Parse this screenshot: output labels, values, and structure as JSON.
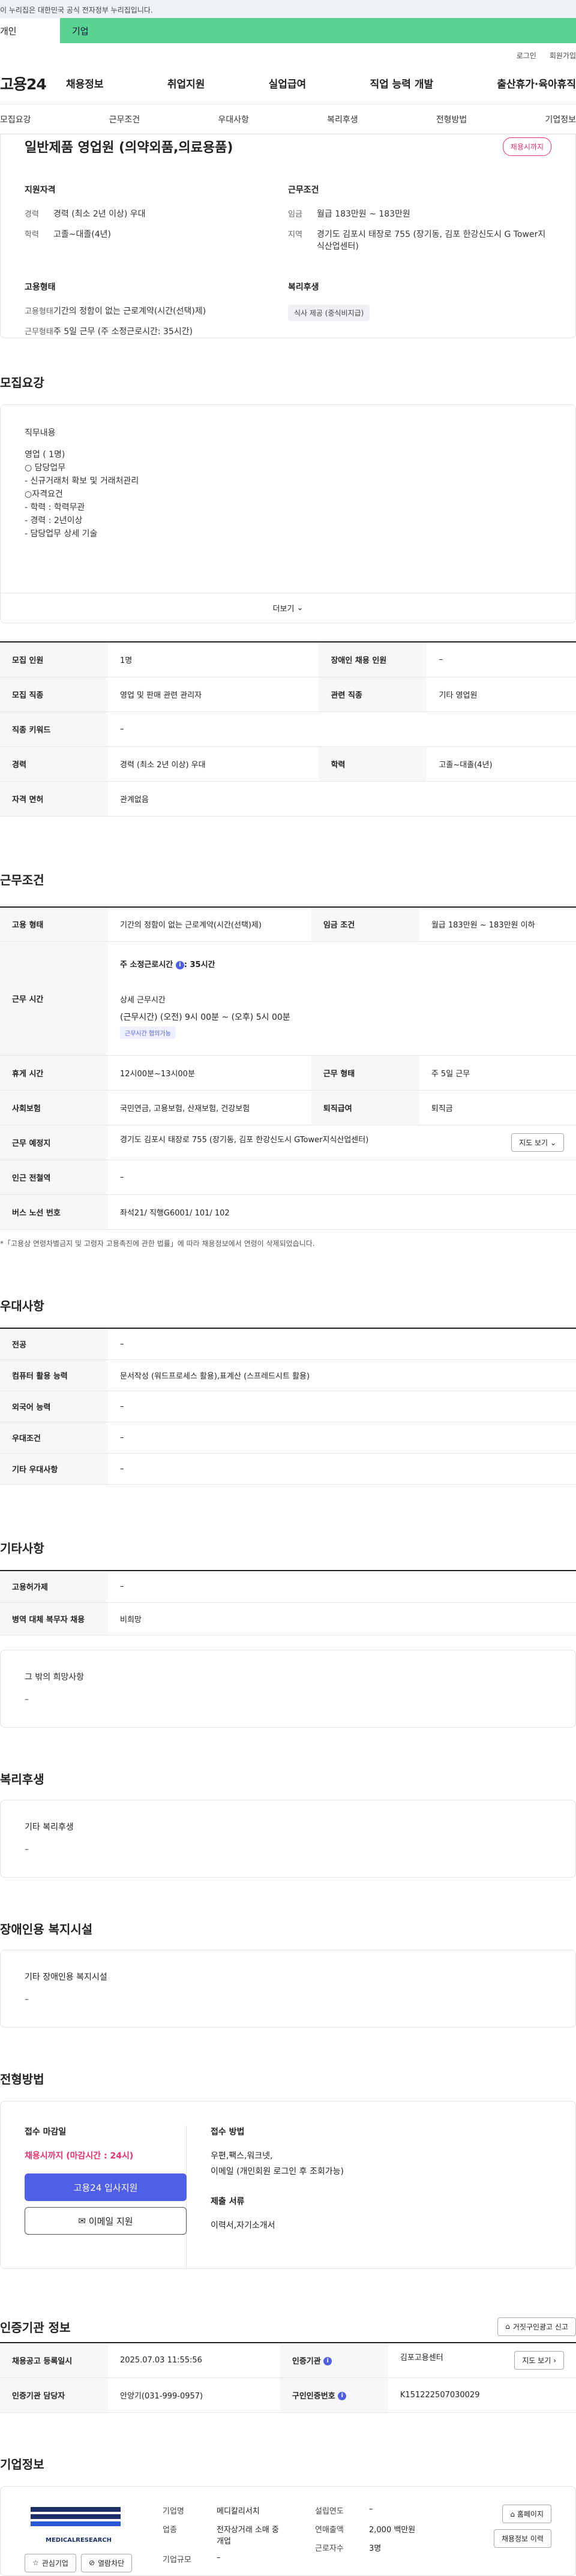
{
  "gov_banner": "이 누리집은 대한민국 공식 전자정부 누리집입니다.",
  "user_tabs": {
    "person": "개인",
    "company": "기업"
  },
  "util_links": [
    "로그인",
    "회원가입"
  ],
  "logo": "고용24",
  "gnb": [
    "채용정보",
    "취업지원",
    "실업급여",
    "직업 능력 개발",
    "출산휴가·육아휴직"
  ],
  "subnav": [
    "모집요강",
    "근무조건",
    "우대사항",
    "복리후생",
    "전형방법",
    "기업정보"
  ],
  "summary": {
    "title": "일반제품 영업원 (의약외품,의료용품)",
    "badge": "채용시까지",
    "qualification_heading": "지원자격",
    "career_label": "경력",
    "career_value": "경력 (최소 2년 이상) 우대",
    "education_label": "학력",
    "education_value": "고졸~대졸(4년)",
    "conditions_heading": "근무조건",
    "wage_label": "임금",
    "wage_value": "월급 183만원 ~ 183만원",
    "region_label": "지역",
    "region_value": "경기도 김포시 태장로 755 (장기동, 김포 한강신도시 G Tower지식산업센터)",
    "employment_heading": "고용형태",
    "emp_type_label": "고용형태",
    "emp_type_value": "기간의 정함이 없는 근로계약(시간(선택)제)",
    "work_type_label": "근무형태",
    "work_type_value": "주 5일 근무 (주 소정근로시간: 35시간)",
    "welfare_heading": "복리후생",
    "welfare_tag": "식사 제공 (중식비지급)"
  },
  "recruit": {
    "heading": "모집요강",
    "duty_heading": "직무내용",
    "lines": [
      "영업 ( 1명)",
      "",
      "○ 담당업무",
      "- 신규거래처 확보 및 거래처관리",
      "",
      "○자격요건",
      "- 학력 : 학력무관",
      "- 경력 : 2년이상",
      "- 담당업무 상세 기술"
    ],
    "more": "더보기"
  },
  "recruit_table": {
    "r1": [
      "모집 인원",
      "1명",
      "장애인 채용 인원",
      "–"
    ],
    "r2": [
      "모집 직종",
      "영업 및 판매 관련 관리자",
      "관련 직종",
      "기타 영업원"
    ],
    "r3": [
      "직종 키워드",
      "–"
    ],
    "r4": [
      "경력",
      "경력 (최소 2년 이상) 우대",
      "학력",
      "고졸~대졸(4년)"
    ],
    "r5": [
      "자격 면허",
      "관계없음"
    ]
  },
  "work": {
    "heading": "근무조건",
    "r1": [
      "고용 형태",
      "기간의 정함이 없는 근로계약(시간(선택)제)",
      "임금 조건",
      "월급 183만원 ~ 183만원 이하"
    ],
    "hours_label": "근무 시간",
    "hours_total": "주 소정근로시간",
    "hours_total_value": ": 35시간",
    "hours_detail_label": "상세 근무시간",
    "hours_detail": "(근무시간) (오전) 9시 00분 ~ (오후) 5시 00분",
    "hours_tag": "근무시간 협의가능",
    "r3": [
      "휴게 시간",
      "12시00분~13시00분",
      "근무 형태",
      "주 5일 근무"
    ],
    "r4": [
      "사회보험",
      "국민연금, 고용보험, 산재보험, 건강보험",
      "퇴직급여",
      "퇴직금"
    ],
    "r5": [
      "근무 예정지",
      "경기도 김포시 태장로 755 (장기동, 김포 한강신도시 GTower지식산업센터)"
    ],
    "map_btn": "지도 보기",
    "r6": [
      "인근 전철역",
      "–"
    ],
    "r7": [
      "버스 노선 번호",
      "좌석21/ 직행G6001/ 101/ 102"
    ],
    "note": "*「고용상 연령차별금지 및 고령자 고용촉진에 관한 법률」에 따라 채용정보에서 연령이 삭제되었습니다."
  },
  "prefer": {
    "heading": "우대사항",
    "r1": [
      "전공",
      "–"
    ],
    "r2": [
      "컴퓨터 활용 능력",
      "문서작성 (워드프로세스 활용),표계산 (스프레드시트 활용)"
    ],
    "r3": [
      "외국어 능력",
      "–"
    ],
    "r4": [
      "우대조건",
      "–"
    ],
    "r5": [
      "기타 우대사항",
      "–"
    ]
  },
  "etc": {
    "heading": "기타사항",
    "r1": [
      "고용허가제",
      "–"
    ],
    "r2": [
      "병역 대체 복무자 채용",
      "비희망"
    ],
    "box_label": "그 밖의 희망사항",
    "box_value": "–"
  },
  "benefit": {
    "heading": "복리후생",
    "label": "기타 복리후생",
    "value": "–"
  },
  "facility": {
    "heading": "장애인용 복지시설",
    "label": "기타 장애인용 복지시설",
    "value": "–"
  },
  "selection": {
    "heading": "전형방법",
    "deadline_label": "접수 마감일",
    "deadline_value": "채용시까지 (마감시간 : 24시)",
    "apply_btn": "고용24 입사지원",
    "email_btn": "이메일 지원",
    "method_label": "접수 방법",
    "method_value": "우편,팩스,워크넷,",
    "method_value2": "이메일 (개인회원 로그인 후 조회가능)",
    "docs_label": "제출 서류",
    "docs_value": "이력서,자기소개서"
  },
  "agency": {
    "heading": "인증기관 정보",
    "report_btn": "거짓구인광고 신고",
    "r1": [
      "채용공고 등록일시",
      "2025.07.03 11:55:56",
      "인증기관",
      "김포고용센터"
    ],
    "r2": [
      "인증기관 담당자",
      "안양기(031-999-0957)",
      "구인인증번호",
      "K151222507030029"
    ],
    "map_btn": "지도 보기"
  },
  "company": {
    "heading": "기업정보",
    "logo_text": "MEDICALRESEARCH",
    "fav_btn": "관심기업",
    "block_btn": "열람차단",
    "name_label": "기업명",
    "name_value": "메디칼리서치",
    "industry_label": "업종",
    "industry_value": "전자상거래 소매 중개업",
    "scale_label": "기업규모",
    "scale_value": "–",
    "founded_label": "설립연도",
    "founded_value": "–",
    "sales_label": "연매출액",
    "sales_value": "2,000 백만원",
    "employees_label": "근로자수",
    "employees_value": "3명",
    "home_btn": "홈페이지",
    "jobs_btn": "채용정보 이력"
  },
  "colors": {
    "accent": "#4f5fe8",
    "due": "#e8326a",
    "company_tab": "#5ad392"
  }
}
